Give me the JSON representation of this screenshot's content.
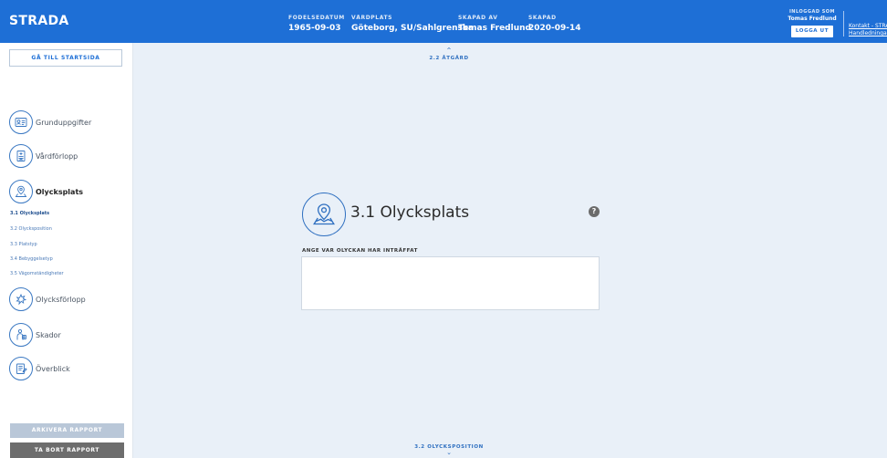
{
  "header": {
    "brand": "STRADA",
    "columns": [
      {
        "label": "FÖDELSEDATUM",
        "value": "1965-09-03"
      },
      {
        "label": "VÅRDPLATS",
        "value": "Göteborg, SU/Sahlgrenska"
      },
      {
        "label": "SKAPAD AV",
        "value": "Tomas Fredlund"
      },
      {
        "label": "SKAPAD",
        "value": "2020-09-14"
      }
    ],
    "login_label": "INLOGGAD SOM",
    "login_user": "Tomas Fredlund",
    "logout_label": "LOGGA UT",
    "link_contact": "Kontakt - STRADA",
    "link_manuals": "Handledningar"
  },
  "sidebar": {
    "home_button": "GÅ TILL STARTSIDA",
    "items": [
      {
        "label": "Grunduppgifter",
        "icon": "id-card-icon"
      },
      {
        "label": "Vårdförlopp",
        "icon": "hospital-icon"
      },
      {
        "label": "Olycksplats",
        "icon": "map-pin-icon",
        "active": true
      },
      {
        "label": "Olycksförlopp",
        "icon": "crash-icon"
      },
      {
        "label": "Skador",
        "icon": "injury-icon"
      },
      {
        "label": "Överblick",
        "icon": "overview-icon"
      }
    ],
    "subitems": [
      {
        "label": "3.1 Olycksplats",
        "active": true
      },
      {
        "label": "3.2 Olycksposition"
      },
      {
        "label": "3.3 Platstyp"
      },
      {
        "label": "3.4 Bebyggelsetyp"
      },
      {
        "label": "3.5 Vägomständigheter"
      }
    ],
    "archive_button": "ARKIVERA RAPPORT",
    "delete_button": "TA BORT RAPPORT"
  },
  "main": {
    "prev_section": "2.2 ÅTGÄRD",
    "next_section": "3.2 OLYCKSPOSITION",
    "section_title": "3.1 Olycksplats",
    "section_icon": "map-pin-icon",
    "help_icon": "help-icon",
    "field_label": "ANGE VAR OLYCKAN HAR INTRÄFFAT",
    "field_value": ""
  },
  "colors": {
    "header_bg": "#1e6fd6",
    "accent": "#2e6fc0",
    "page_bg": "#e9f0f8",
    "delete_btn": "#6d6d6d",
    "archive_btn": "#b9c7d8"
  }
}
